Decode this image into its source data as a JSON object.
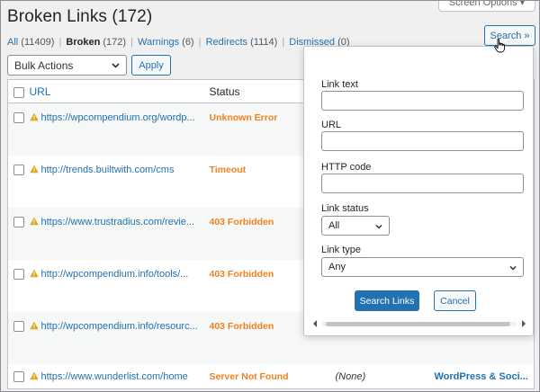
{
  "page": {
    "title": "Broken Links (172)",
    "screen_options": "Screen Options ▾"
  },
  "filters": [
    {
      "label": "All",
      "count": "(11409)"
    },
    {
      "label": "Broken",
      "count": "(172)"
    },
    {
      "label": "Warnings",
      "count": "(6)"
    },
    {
      "label": "Redirects",
      "count": "(1114)"
    },
    {
      "label": "Dismissed",
      "count": "(0)"
    }
  ],
  "toolbar": {
    "bulk_actions": "Bulk Actions",
    "apply": "Apply",
    "search": "Search »"
  },
  "table": {
    "headers": {
      "url": "URL",
      "status": "Status"
    },
    "rows": [
      {
        "url": "https://wpcompendium.org/wordp...",
        "status": "Unknown Error",
        "text": "",
        "source": ""
      },
      {
        "url": "http://trends.builtwith.com/cms",
        "status": "Timeout",
        "text": "",
        "source": ""
      },
      {
        "url": "https://www.trustradius.com/revie...",
        "status": "403 Forbidden",
        "text": "",
        "source": ""
      },
      {
        "url": "http://wpcompendium.info/tools/...",
        "status": "403 Forbidden",
        "text": "",
        "source": ""
      },
      {
        "url": "http://wpcompendium.info/resourc...",
        "status": "403 Forbidden",
        "text": "",
        "source": ""
      },
      {
        "url": "https://www.wunderlist.com/home",
        "status": "Server Not Found",
        "text": "(None)",
        "source": "WordPress & Soci..."
      }
    ]
  },
  "search_panel": {
    "link_text_label": "Link text",
    "link_text_value": "",
    "url_label": "URL",
    "url_value": "",
    "http_code_label": "HTTP code",
    "http_code_value": "",
    "link_status_label": "Link status",
    "link_status_value": "All",
    "link_type_label": "Link type",
    "link_type_value": "Any",
    "search_button": "Search Links",
    "cancel_button": "Cancel"
  },
  "colors": {
    "accent": "#2271b1",
    "status_error": "#f0821e",
    "warning_icon": "#dba617",
    "background": "#f0f0f1"
  }
}
